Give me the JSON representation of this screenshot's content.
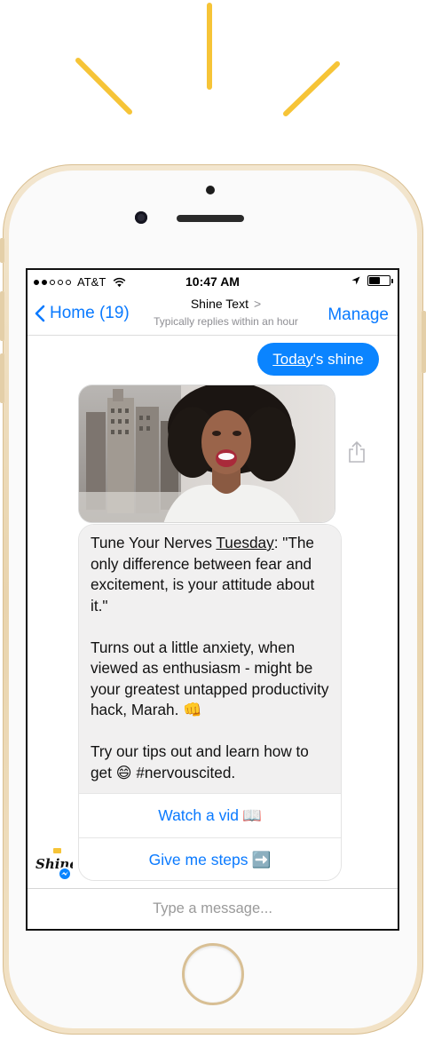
{
  "status_bar": {
    "carrier": "AT&T",
    "time": "10:47 AM",
    "icons": [
      "signal-dots-icon",
      "wifi-icon",
      "location-arrow-icon",
      "battery-icon"
    ]
  },
  "nav": {
    "back_label": "Home (19)",
    "title": "Shine Text",
    "title_chevron": ">",
    "subtitle": "Typically replies within an hour",
    "manage_label": "Manage"
  },
  "thread": {
    "outgoing": {
      "link_word": "Today",
      "rest": "'s shine"
    },
    "card": {
      "p1_lead": "Tune Your Nerves ",
      "p1_day": "Tuesday",
      "p1_rest": ": \"The only difference between fear and excitement, is your attitude about it.\"",
      "p2": "Turns out a little anxiety, when viewed as enthusiasm - might be your greatest untapped productivity hack, Marah. 👊",
      "p3": "Try our tips out and learn how to get 😄  #nervouscited.",
      "buttons": [
        {
          "label": "Watch a vid",
          "emoji": "📖"
        },
        {
          "label": "Give me steps",
          "emoji": "➡️"
        }
      ]
    },
    "avatar_brand": "Shine"
  },
  "composer": {
    "placeholder": "Type a message..."
  },
  "colors": {
    "accent": "#0a7aff",
    "outgoing_bubble": "#0a84ff",
    "incoming_bubble": "#f1f0f0",
    "ray": "#f6c437",
    "phone_gold": "#e9d4ad"
  }
}
